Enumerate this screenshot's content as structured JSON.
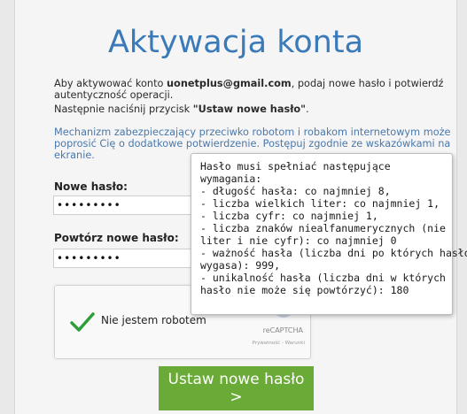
{
  "page": {
    "title": "Aktywacja konta",
    "intro": {
      "prefix": "Aby aktywować konto ",
      "email": "uonetplus@gmail.com",
      "suffix_line1": ", podaj nowe hasło i potwierdź",
      "line2": "autentyczność operacji.",
      "line3_prefix": "Następnie naciśnij przycisk ",
      "line3_button": "\"Ustaw nowe hasło\"",
      "line3_suffix": "."
    },
    "mechanism": {
      "line1": "Mechanizm zabezpieczający przeciwko robotom i robakom internetowym może",
      "line2": "poprosić Cię o dodatkowe potwierdzenie. Postępuj zgodnie ze wskazówkami na",
      "line3": "ekranie."
    },
    "new_password": {
      "label": "Nowe hasło:",
      "value": "•••••••••"
    },
    "repeat_password": {
      "label": "Powtórz nowe hasło:",
      "value": "•••••••••"
    },
    "recaptcha": {
      "label": "Nie jestem robotem",
      "brand": "reCAPTCHA",
      "links": "Prywatność - Warunki",
      "check_color": "#2e9e3a"
    },
    "submit_label": "Ustaw nowe hasło >",
    "tooltip": {
      "lines": [
        "Hasło musi spełniać następujące",
        "wymagania:",
        "- długość hasła: co najmniej 8,",
        "- liczba wielkich liter: co najmniej 1,",
        "- liczba cyfr: co najmniej 1,",
        "- liczba znaków niealfanumerycznych (nie",
        "liter i nie cyfr): co najmniej 0",
        "- ważność hasła (liczba dni po których hasło",
        "wygasa): 999,",
        "- unikalność hasła (liczba dni w których",
        "hasło nie może się powtórzyć): 180"
      ]
    }
  },
  "colors": {
    "title": "#3a7ab8",
    "link_text": "#4a78aa",
    "button": "#6aaa36"
  }
}
